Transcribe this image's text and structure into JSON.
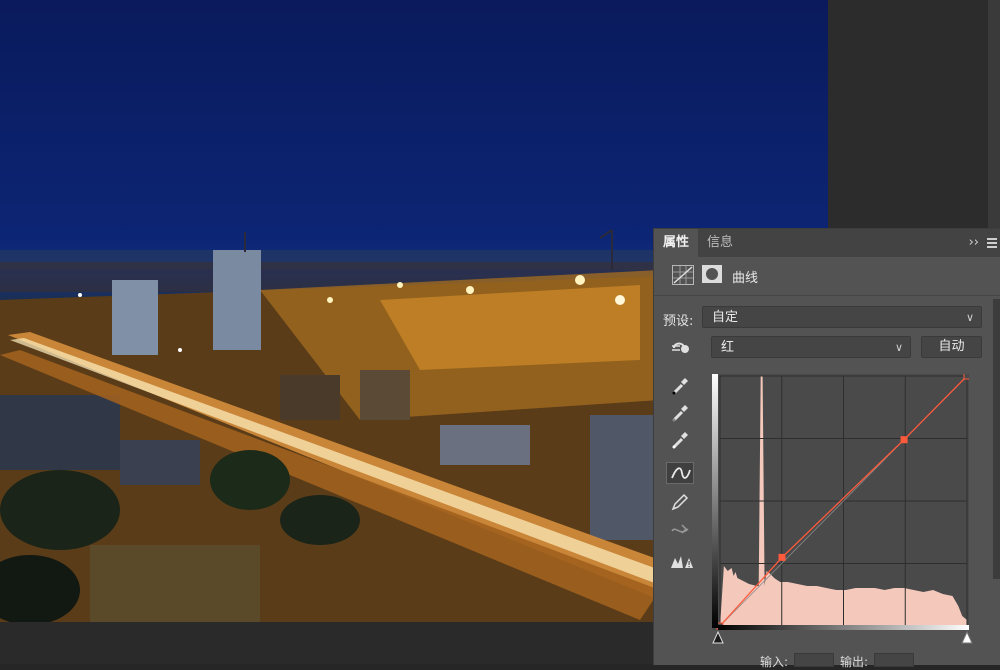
{
  "panel": {
    "tabs": [
      "属性",
      "信息"
    ],
    "more_label": "››",
    "adjustment_title": "曲线",
    "preset_label": "预设:",
    "preset_value": "自定",
    "channel_value": "红",
    "auto_button": "自动",
    "input_label": "输入:",
    "output_label": "输出:"
  },
  "curve": {
    "channel_color": "#ff5a3c",
    "control_points": [
      [
        0,
        0
      ],
      [
        64,
        70
      ],
      [
        190,
        190
      ],
      [
        255,
        255
      ]
    ],
    "histogram_color": "#f4c8bb"
  },
  "icons": {
    "tools": [
      "target-adjust-icon",
      "black-point-eyedropper-icon",
      "gray-point-eyedropper-icon",
      "white-point-eyedropper-icon",
      "curve-points-icon",
      "pencil-icon",
      "smooth-icon",
      "clipping-warning-icon"
    ]
  }
}
